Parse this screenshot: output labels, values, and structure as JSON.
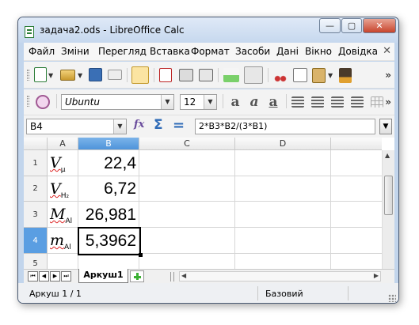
{
  "window": {
    "title": "задача2.ods - LibreOffice Calc",
    "controls": {
      "minimize": "—",
      "maximize": "▢",
      "close": "✕"
    }
  },
  "menu": {
    "items": [
      "Файл",
      "Зміни",
      "Перегляд",
      "Вставка",
      "Формат",
      "Засоби",
      "Дані",
      "Вікно",
      "Довідка"
    ],
    "close": "✕"
  },
  "toolbar": {
    "icons": [
      "new-icon",
      "open-icon",
      "save-icon",
      "email-icon",
      "edit-mode-icon",
      "pdf-export-icon",
      "print-icon",
      "print-preview-icon",
      "spellcheck-icon",
      "autospellcheck-icon",
      "cut-icon",
      "copy-icon",
      "paste-icon",
      "clone-format-icon"
    ],
    "more": "»"
  },
  "format": {
    "font_name": "Ubuntu",
    "font_size": "12",
    "more": "»"
  },
  "formula": {
    "name_box": "B4",
    "fx_label": "fx",
    "sigma_label": "Σ",
    "equals_label": "=",
    "input": "2*B3*B2/(3*B1)"
  },
  "grid": {
    "columns": [
      "A",
      "B",
      "C",
      "D"
    ],
    "rows": [
      "1",
      "2",
      "3",
      "4",
      "5"
    ],
    "cells": [
      {
        "a_main": "V",
        "a_sub": "μ",
        "b": "22,4"
      },
      {
        "a_main": "V",
        "a_sub": "H₂",
        "b": "6,72"
      },
      {
        "a_main": "M",
        "a_sub": "Al",
        "b": "26,981"
      },
      {
        "a_main": "m",
        "a_sub": "Al",
        "b": "5,3962"
      }
    ],
    "selected_cell": "B4"
  },
  "sheets": {
    "tabs": [
      "Аркуш1"
    ]
  },
  "status": {
    "sheet": "Аркуш 1 / 1",
    "style": "Базовий"
  },
  "colors": {
    "selection": "#5a9ee2",
    "window_frame": "#c2d5ec"
  }
}
